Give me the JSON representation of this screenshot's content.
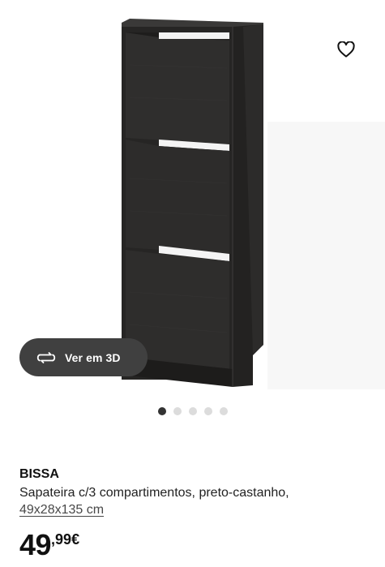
{
  "gallery": {
    "image_alt": "BISSA shoe cabinet, black-brown",
    "favourite_icon": "heart-outline-icon",
    "view3d_label": "Ver em 3D",
    "view3d_icon": "rotate-3d-icon",
    "slides_total": 5,
    "slide_active_index": 0
  },
  "product": {
    "name": "BISSA",
    "description": "Sapateira c/3 compartimentos, preto-castanho,",
    "dimensions": "49x28x135 cm",
    "price": {
      "integer": "49",
      "decimals": ",99",
      "currency": "€"
    }
  },
  "colors": {
    "cabinet": "#2b2a29",
    "button_bg": "#404040",
    "dot_active": "#333333",
    "dot_inactive": "#dcdcdc"
  }
}
